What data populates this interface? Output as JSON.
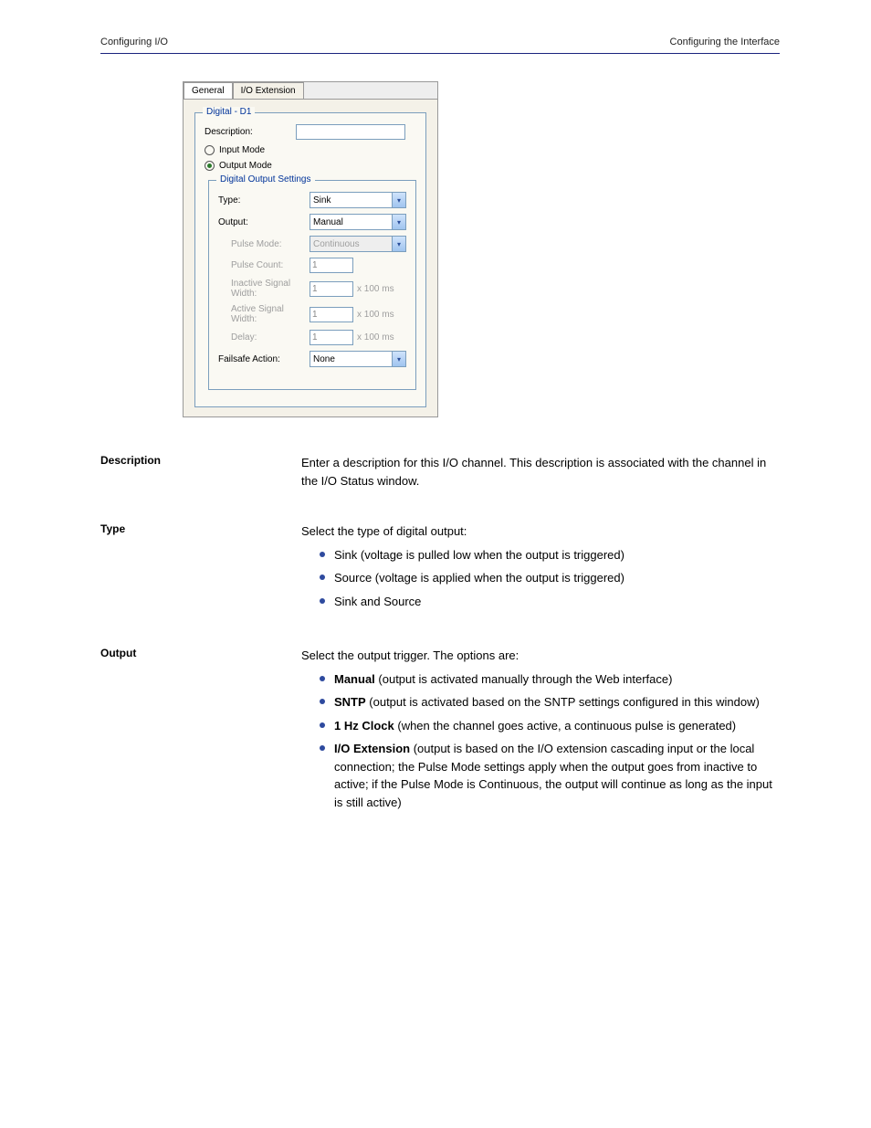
{
  "header": {
    "left": "Configuring I/O",
    "right": "Configuring the Interface"
  },
  "screenshot": {
    "tabs": [
      "General",
      "I/O Extension"
    ],
    "active_tab": 0,
    "group_title": "Digital - D1",
    "description_label": "Description:",
    "description_value": "",
    "input_mode_label": "Input Mode",
    "output_mode_label": "Output Mode",
    "output_group_title": "Digital Output Settings",
    "rows": {
      "type": {
        "label": "Type:",
        "value": "Sink"
      },
      "output": {
        "label": "Output:",
        "value": "Manual"
      },
      "pulse_mode": {
        "label": "Pulse Mode:",
        "value": "Continuous"
      },
      "pulse_count": {
        "label": "Pulse Count:",
        "value": "1"
      },
      "inactive": {
        "label": "Inactive Signal Width:",
        "value": "1",
        "unit": "x 100 ms"
      },
      "active": {
        "label": "Active Signal Width:",
        "value": "1",
        "unit": "x 100 ms"
      },
      "delay": {
        "label": "Delay:",
        "value": "1",
        "unit": "x 100 ms"
      },
      "failsafe": {
        "label": "Failsafe Action:",
        "value": "None"
      }
    }
  },
  "defs": {
    "description": {
      "term": "Description",
      "body": "Enter a description for this I/O channel. This description is associated with the channel in the I/O Status window."
    },
    "type": {
      "term": "Type",
      "intro": "Select the type of digital output:",
      "items": [
        "Sink (voltage is pulled low when the output is triggered)",
        "Source (voltage is applied when the output is triggered)",
        "Sink and Source"
      ]
    },
    "output": {
      "term": "Output",
      "intro": "Select the output trigger. The options are:",
      "items": [
        {
          "lead": "Manual",
          "rest": " (output is activated manually through the Web interface)"
        },
        {
          "lead": "SNTP",
          "rest": " (output is activated based on the SNTP settings configured in this window)"
        },
        {
          "lead": "1 Hz Clock",
          "rest": " (when the channel goes active, a continuous pulse is generated)"
        },
        {
          "lead": "I/O Extension",
          "rest": " (output is based on the I/O extension cascading input or the local connection; the Pulse Mode settings apply when the output goes from inactive to active; if the Pulse Mode is Continuous, the output will continue as long as the input is still active)"
        }
      ]
    }
  }
}
